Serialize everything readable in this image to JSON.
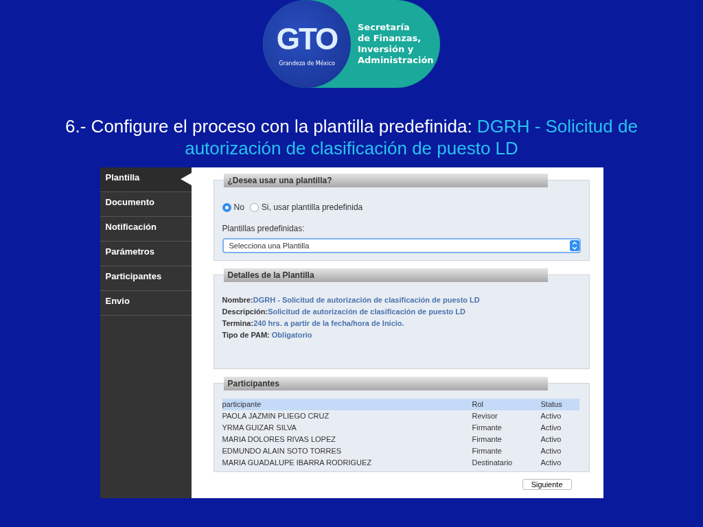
{
  "logo": {
    "mark": "GTO",
    "tagline": "Grandeza de México",
    "org_lines": [
      "Secretaría",
      "de Finanzas,",
      "Inversión y",
      "Administración"
    ]
  },
  "title": {
    "text": "6.- Configure el proceso con la plantilla predefinida: ",
    "highlight": "DGRH - Solicitud de autorización de clasificación de puesto LD"
  },
  "sidebar": {
    "items": [
      {
        "label": "Plantilla",
        "selected": true
      },
      {
        "label": "Documento",
        "selected": false
      },
      {
        "label": "Notificación",
        "selected": false
      },
      {
        "label": "Parámetros",
        "selected": false
      },
      {
        "label": "Participantes",
        "selected": false
      },
      {
        "label": "Envio",
        "selected": false
      }
    ]
  },
  "template_choice": {
    "heading": "¿Desea usar una plantilla?",
    "options": [
      {
        "label": "No",
        "selected": true
      },
      {
        "label": "Si, usar plantilla predefinida",
        "selected": false
      }
    ],
    "select_label": "Plantillas predefinidas:",
    "select_value": "Selecciona una Plantilla"
  },
  "details": {
    "heading": "Detalles de la Plantilla",
    "fields": [
      {
        "label": "Nombre:",
        "value": "DGRH - Solicitud de autorización de clasificación de puesto LD"
      },
      {
        "label": "Descripción:",
        "value": "Solicitud de autorización de clasificación de puesto LD"
      },
      {
        "label": "Termina:",
        "value": "240 hrs. a partir de la fecha/hora de Inicio."
      },
      {
        "label": "Tipo de PAM: ",
        "value": "Obligatorio"
      }
    ]
  },
  "participants": {
    "heading": "Participantes",
    "columns": [
      "participante",
      "Rol",
      "Status"
    ],
    "rows": [
      [
        "PAOLA JAZMIN PLIEGO CRUZ",
        "Revisor",
        "Activo"
      ],
      [
        "YRMA GUIZAR SILVA",
        "Firmante",
        "Activo"
      ],
      [
        "MARIA DOLORES RIVAS LOPEZ",
        "Firmante",
        "Activo"
      ],
      [
        "EDMUNDO ALAIN SOTO TORRES",
        "Firmante",
        "Activo"
      ],
      [
        "MARIA GUADALUPE IBARRA RODRIGUEZ",
        "Destinatario",
        "Activo"
      ]
    ]
  },
  "next_button": "Siguiente"
}
